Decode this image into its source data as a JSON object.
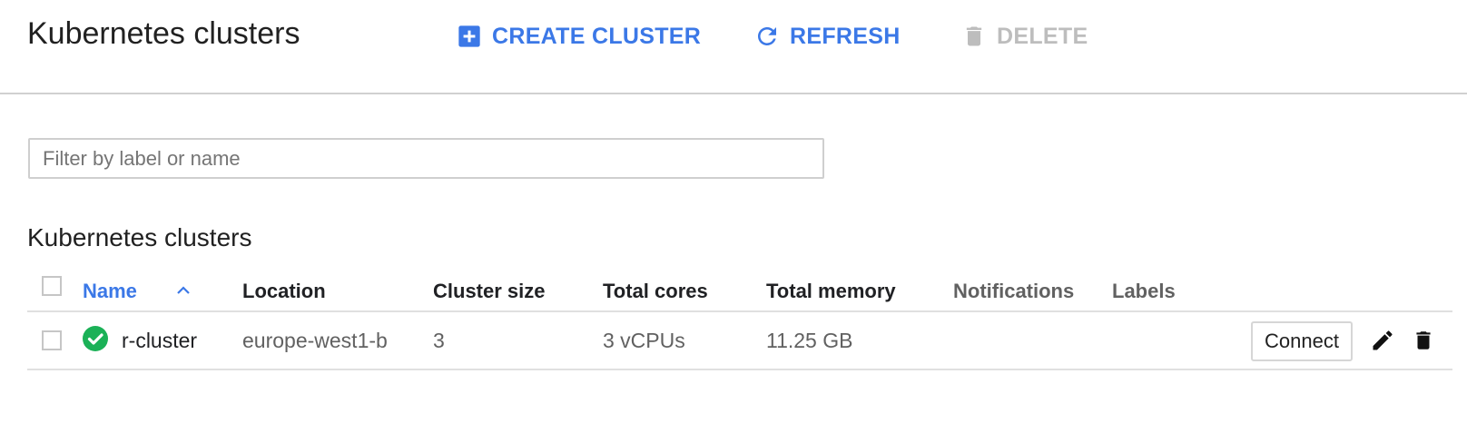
{
  "header": {
    "title": "Kubernetes clusters",
    "create_label": "CREATE CLUSTER",
    "refresh_label": "REFRESH",
    "delete_label": "DELETE"
  },
  "filter": {
    "placeholder": "Filter by label or name",
    "value": ""
  },
  "section": {
    "title": "Kubernetes clusters"
  },
  "table": {
    "columns": [
      "Name",
      "Location",
      "Cluster size",
      "Total cores",
      "Total memory",
      "Notifications",
      "Labels"
    ],
    "sort": {
      "column": "Name",
      "direction": "ascending"
    },
    "rows": [
      {
        "status": "ok",
        "status_icon": "check-circle-icon",
        "name": "r-cluster",
        "location": "europe-west1-b",
        "cluster_size": "3",
        "total_cores": "3 vCPUs",
        "total_memory": "11.25 GB",
        "notifications": "",
        "labels": "",
        "connect_label": "Connect"
      }
    ]
  },
  "colors": {
    "accent": "#3b78e7",
    "disabled": "#bdbdbd",
    "status_ok": "#1bb157",
    "divider": "#e0e0e0"
  }
}
